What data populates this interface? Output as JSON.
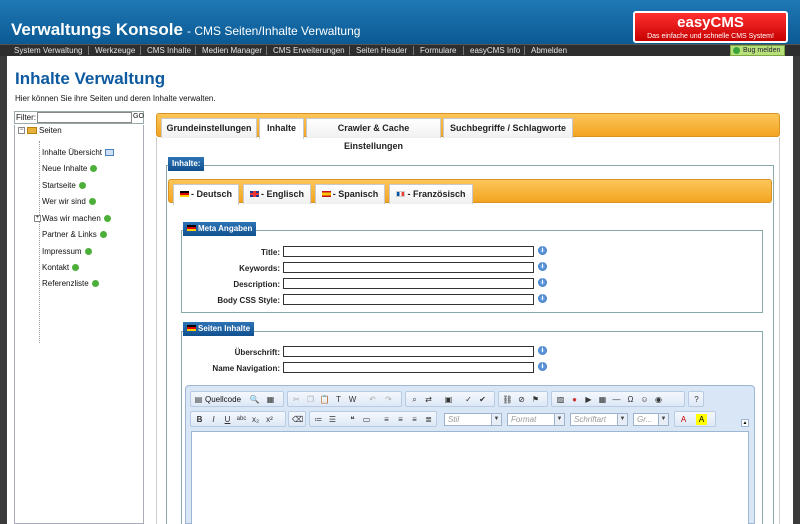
{
  "header": {
    "title": "Verwaltungs Konsole",
    "subtitle": "- CMS Seiten/Inhalte Verwaltung",
    "logo_name": "easyCMS",
    "logo_slogan": "Das einfache und schnelle CMS System!"
  },
  "nav": {
    "items": [
      "System Verwaltung",
      "Werkzeuge",
      "CMS Inhalte",
      "Medien Manager",
      "CMS Erweiterungen",
      "Seiten Header",
      "Formulare",
      "easyCMS Info",
      "Abmelden"
    ],
    "bug_label": "Bug melden"
  },
  "page": {
    "title": "Inhalte Verwaltung",
    "description": "Hier können Sie ihre Seiten und deren Inhalte verwalten."
  },
  "sidebar": {
    "filter_label": "Filter:",
    "filter_value": "",
    "go_label": "GO",
    "root_label": "Seiten",
    "items": [
      {
        "label": "Inhalte Übersicht"
      },
      {
        "label": "Neue Inhalte"
      },
      {
        "label": "Startseite"
      },
      {
        "label": "Wer wir sind"
      },
      {
        "label": "Was wir machen"
      },
      {
        "label": "Partner & Links"
      },
      {
        "label": "Impressum"
      },
      {
        "label": "Kontakt"
      },
      {
        "label": "Referenzliste"
      }
    ]
  },
  "tabs": {
    "items": [
      "Grundeinstellungen",
      "Inhalte",
      "Crawler & Cache Einstellungen",
      "Suchbegriffe / Schlagworte"
    ],
    "active": "Inhalte"
  },
  "content": {
    "legend": "Inhalte:",
    "languages": [
      "- Deutsch",
      "- Englisch",
      "- Spanisch",
      "- Französisch"
    ],
    "meta": {
      "legend": "Meta Angaben",
      "fields": [
        {
          "label": "Title:",
          "value": ""
        },
        {
          "label": "Keywords:",
          "value": ""
        },
        {
          "label": "Description:",
          "value": ""
        },
        {
          "label": "Body CSS Style:",
          "value": ""
        }
      ]
    },
    "page_content": {
      "legend": "Seiten Inhalte",
      "fields": [
        {
          "label": "Überschrift:",
          "value": ""
        },
        {
          "label": "Name Navigation:",
          "value": ""
        }
      ]
    },
    "editor": {
      "source_label": "Quellcode",
      "combos": [
        "Stil",
        "Format",
        "Schriftart",
        "Gr..."
      ]
    }
  },
  "colors": {
    "header_blue": "#1f78b4",
    "tab_orange": "#f3a421",
    "legend_blue": "#2d74b5",
    "logo_red": "#d00000",
    "status_ok": "#4caf3a"
  }
}
